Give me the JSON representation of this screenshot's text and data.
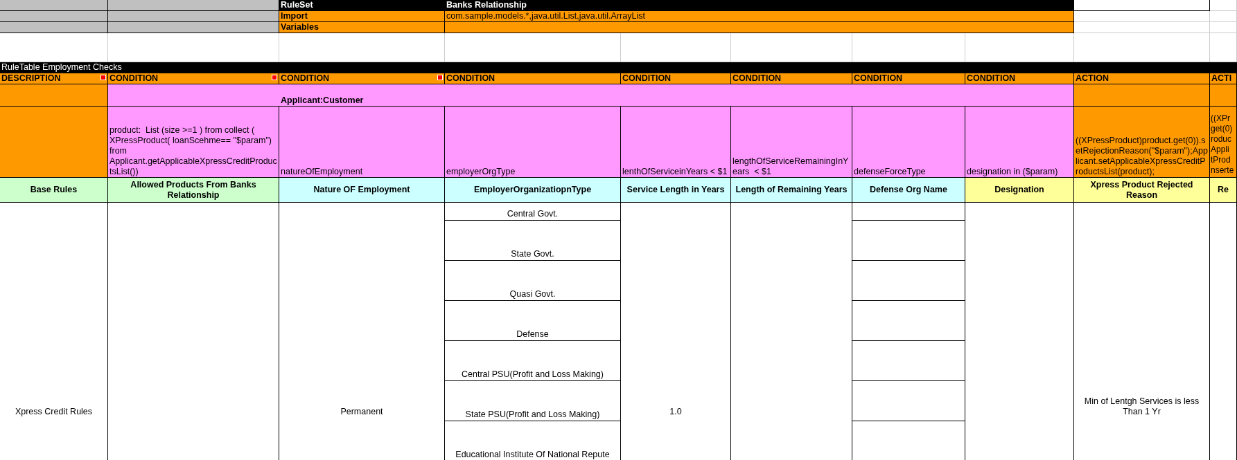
{
  "ruleset": {
    "rows": [
      {
        "kind": "title",
        "label": "RuleSet",
        "value": "Banks Relationship"
      },
      {
        "kind": "field",
        "label": "Import",
        "value": "com.sample.models.*,java.util.List,java.util.ArrayList"
      },
      {
        "kind": "field",
        "label": "Variables"
      }
    ]
  },
  "rule_table": {
    "title": "RuleTable Employment Checks",
    "object_type": "Applicant:Customer",
    "columns": [
      {
        "type": "DESCRIPTION",
        "comment": true,
        "heading": "Base Rules",
        "color": "#ccffcc"
      },
      {
        "type": "CONDITION",
        "comment": true,
        "code": "product:  List (size >=1 ) from collect ( XPressProduct( loanScehme== \"$param\") from Applicant.getApplicableXpressCreditProductsList())",
        "heading": "Allowed Products From Banks Relationship",
        "color": "#ccffcc"
      },
      {
        "type": "CONDITION",
        "comment": true,
        "code": "natureOfEmployment",
        "heading": "Nature OF Employment",
        "color": "#ccffff"
      },
      {
        "type": "CONDITION",
        "comment": false,
        "code": "employerOrgType",
        "heading": "EmployerOrganizatiopnType",
        "color": "#ccffff"
      },
      {
        "type": "CONDITION",
        "comment": false,
        "code": "lenthOfServiceinYears < $1",
        "heading": "Service Length in Years",
        "color": "#ccffff"
      },
      {
        "type": "CONDITION",
        "comment": false,
        "code": "lengthOfServiceRemainingInYears  < $1",
        "heading": "Length of Remaining Years",
        "color": "#ccffff"
      },
      {
        "type": "CONDITION",
        "comment": false,
        "code": "defenseForceType",
        "heading": "Defense Org Name",
        "color": "#ccffff"
      },
      {
        "type": "CONDITION",
        "comment": false,
        "code": "designation in ($param)",
        "heading": "Designation",
        "color": "#ffff99"
      },
      {
        "type": "ACTION",
        "comment": false,
        "code": "((XPressProduct)product.get(0)).setRejectionReason(\"$param\");Applicant.setApplicableXpressCreditProductsList(product);",
        "heading": "Xpress Product Rejected Reason",
        "color": "#ffff99"
      },
      {
        "type": "ACTI",
        "comment": false,
        "code": [
          "((XPr",
          "get(0)",
          "roduc",
          "Appli",
          "tProd",
          "nserte"
        ],
        "heading": "Re",
        "color": "#ffff99"
      }
    ],
    "rows": [
      {
        "cells": [
          {
            "text": "Xpress Credit Rules"
          },
          {},
          {
            "text": "Permanent"
          },
          {
            "items": [
              "Central Govt.",
              "State Govt.",
              "Quasi Govt.",
              "Defense",
              "Central PSU(Profit and Loss Making)",
              "State PSU(Profit and Loss Making)",
              "Educational Institute Of National Repute"
            ]
          },
          {
            "text": "1.0"
          },
          {},
          {
            "split": true
          },
          {},
          {
            "text": "Min of Lentgh Services is less Than 1 Yr"
          },
          {}
        ]
      }
    ]
  }
}
